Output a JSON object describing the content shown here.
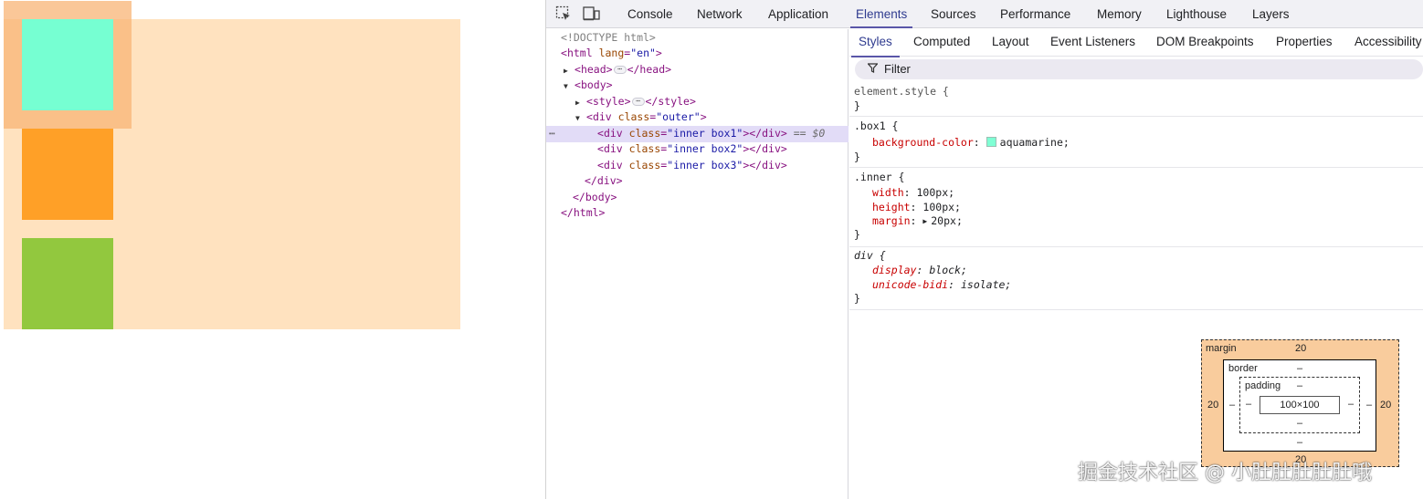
{
  "devtools": {
    "tabs": [
      "Console",
      "Network",
      "Application",
      "Elements",
      "Sources",
      "Performance",
      "Memory",
      "Lighthouse",
      "Layers"
    ],
    "active_tab": "Elements",
    "dom": {
      "doctype": "<!DOCTYPE html>",
      "html_open": "html",
      "html_lang_attr": "lang",
      "html_lang_val": "\"en\"",
      "head": "head",
      "body": "body",
      "style": "style",
      "div_tag": "div",
      "class_attr": "class",
      "outer_val": "\"outer\"",
      "inner_box1_val": "\"inner box1\"",
      "inner_box2_val": "\"inner box2\"",
      "inner_box3_val": "\"inner box3\"",
      "selected_marker": "== $0",
      "close_div": "</div>",
      "close_body": "</body>",
      "close_html": "</html>",
      "close_head": "</head>",
      "close_style": "</style>"
    },
    "styles_pane": {
      "subtabs": [
        "Styles",
        "Computed",
        "Layout",
        "Event Listeners",
        "DOM Breakpoints",
        "Properties",
        "Accessibility"
      ],
      "active_subtab": "Styles",
      "filter_placeholder": "Filter",
      "rules": [
        {
          "selector": "element.style {",
          "declarations": []
        },
        {
          "selector": ".box1 {",
          "declarations": [
            {
              "prop": "background-color",
              "value": "aquamarine;"
            }
          ]
        },
        {
          "selector": ".inner {",
          "declarations": [
            {
              "prop": "width",
              "value": "100px;"
            },
            {
              "prop": "height",
              "value": "100px;"
            },
            {
              "prop": "margin",
              "value": "20px;"
            }
          ]
        },
        {
          "selector": "div {",
          "declarations": [
            {
              "prop": "display",
              "value": "block;"
            },
            {
              "prop": "unicode-bidi",
              "value": "isolate;"
            }
          ]
        }
      ],
      "close_brace": "}",
      "colon": ":"
    },
    "box_model": {
      "margin_label": "margin",
      "margin_top": "20",
      "margin_left": "20",
      "margin_right": "20",
      "margin_bottom": "20",
      "border_label": "border",
      "border_value": "–",
      "padding_label": "padding",
      "padding_value": "–",
      "content_size": "100×100"
    }
  },
  "watermark": "掘金技术社区 @ 小肚肚肚肚肚哦",
  "colors": {
    "outer_bg": "#ffe2bf",
    "box1": "#7fffd4",
    "box2": "#ffa027",
    "box3": "#92c83e",
    "accent": "#5a56a8"
  }
}
